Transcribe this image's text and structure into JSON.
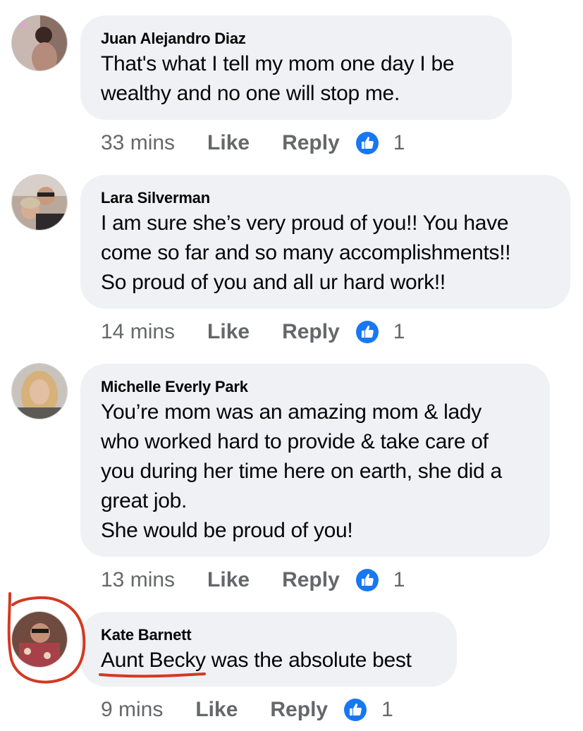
{
  "comments": [
    {
      "author": "Juan Alejandro Diaz",
      "text": "That's what I tell my  mom one day I be\nwealthy and no one will stop me.",
      "time": "33 mins",
      "like_label": "Like",
      "reply_label": "Reply",
      "reaction_icon": "thumbs-up-icon",
      "reaction_count": "1"
    },
    {
      "author": "Lara Silverman",
      "text": "I am sure she’s very proud of you!! You have\ncome so far and so many accomplishments!!\nSo proud of you and all ur hard work!!",
      "time": "14 mins",
      "like_label": "Like",
      "reply_label": "Reply",
      "reaction_icon": "thumbs-up-icon",
      "reaction_count": "1"
    },
    {
      "author": "Michelle Everly Park",
      "text": "You’re mom was an amazing mom & lady\nwho worked hard to provide & take care of\nyou during her time here on earth, she did a\ngreat job.\nShe would be proud of you!",
      "time": "13 mins",
      "like_label": "Like",
      "reply_label": "Reply",
      "reaction_icon": "thumbs-up-icon",
      "reaction_count": "1"
    },
    {
      "author": "Kate Barnett",
      "text": "Aunt Becky was the absolute best",
      "time": "9 mins",
      "like_label": "Like",
      "reply_label": "Reply",
      "reaction_icon": "thumbs-up-icon",
      "reaction_count": "1"
    }
  ],
  "colors": {
    "bubble": "#eff1f5",
    "meta_text": "#65676b",
    "like_blue": "#1877f2",
    "annotation_red": "#d23a22"
  }
}
